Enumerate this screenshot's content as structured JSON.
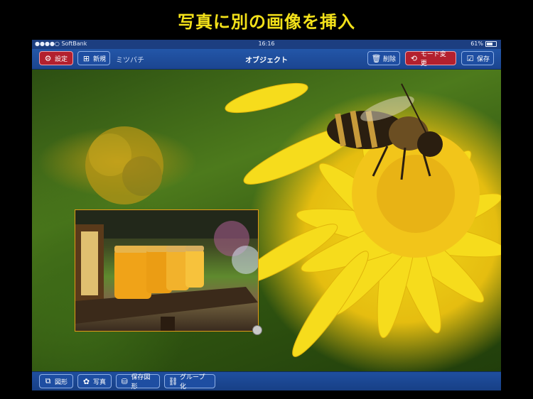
{
  "headline": "写真に別の画像を挿入",
  "status_bar": {
    "carrier": "●●●●○ SoftBank",
    "time": "16:16",
    "battery": "61%"
  },
  "toolbar": {
    "settings_label": "設定",
    "new_label": "新規",
    "document_name": "ミツバチ",
    "title": "オブジェクト",
    "delete_label": "削除",
    "mode_change_label": "モード変更",
    "save_label": "保存"
  },
  "bottom_bar": {
    "shape_label": "図形",
    "photo_label": "写真",
    "saved_shape_label": "保存図形",
    "group_label": "グループ化"
  },
  "colors": {
    "headline": "#f3e11a",
    "toolbar_blue": "#1f4f9f",
    "accent_red": "#b3202e",
    "selection_border": "#e39a18"
  }
}
